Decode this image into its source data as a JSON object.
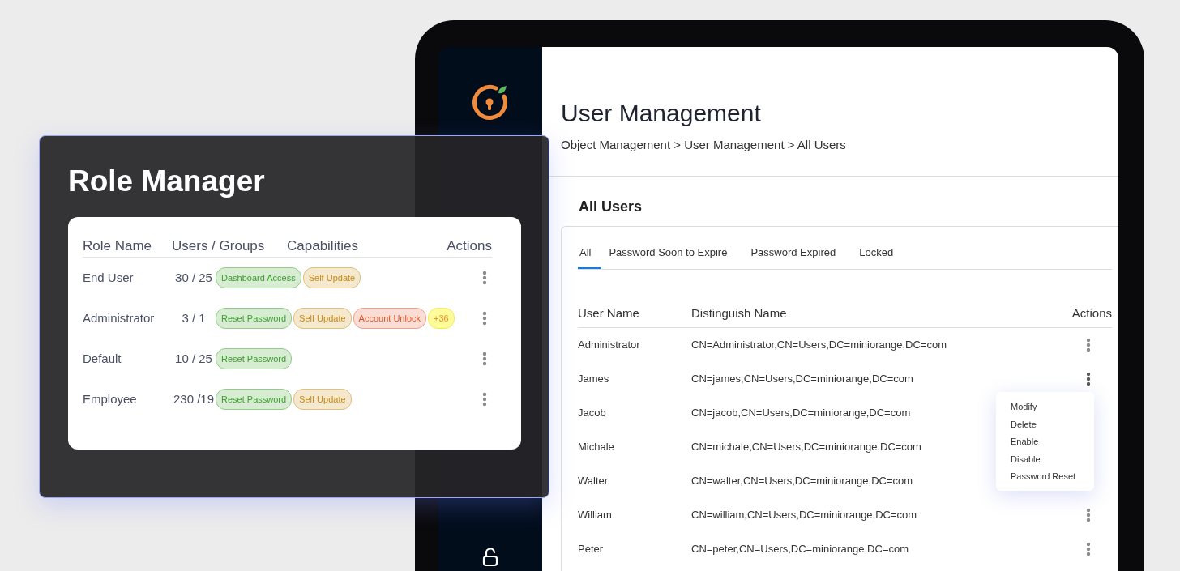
{
  "sidebar": {
    "items": [
      {
        "kind": "logo"
      },
      {
        "kind": "lock"
      }
    ]
  },
  "user_management": {
    "title": "User Management",
    "breadcrumb": "Object Management > User Management > All Users",
    "section_title": "All Users",
    "tabs": [
      {
        "label": "All",
        "selected": true
      },
      {
        "label": "Password Soon to Expire",
        "selected": false
      },
      {
        "label": "Password Expired",
        "selected": false
      },
      {
        "label": "Locked",
        "selected": false
      }
    ],
    "columns": [
      "User Name",
      "Distinguish Name",
      "Actions"
    ],
    "rows": [
      {
        "name": "Administrator",
        "dn": "CN=Administrator,CN=Users,DC=miniorange,DC=com",
        "menu_open": false
      },
      {
        "name": "James",
        "dn": "CN=james,CN=Users,DC=miniorange,DC=com",
        "menu_open": true
      },
      {
        "name": "Jacob",
        "dn": "CN=jacob,CN=Users,DC=miniorange,DC=com",
        "menu_open": false
      },
      {
        "name": "Michale",
        "dn": "CN=michale,CN=Users,DC=miniorange,DC=com",
        "menu_open": false
      },
      {
        "name": "Walter",
        "dn": "CN=walter,CN=Users,DC=miniorange,DC=com",
        "menu_open": false
      },
      {
        "name": "William",
        "dn": "CN=william,CN=Users,DC=miniorange,DC=com",
        "menu_open": false
      },
      {
        "name": "Peter",
        "dn": "CN=peter,CN=Users,DC=miniorange,DC=com",
        "menu_open": false
      }
    ],
    "menu": [
      "Modify",
      "Delete",
      "Enable",
      "Disable",
      "Password Reset"
    ]
  },
  "role_manager": {
    "title": "Role Manager",
    "columns": [
      "Role Name",
      "Users / Groups",
      "Capabilities",
      "Actions"
    ],
    "roles": [
      {
        "name": "End User",
        "count": "30 / 25",
        "capabilities": [
          {
            "label": "Dashboard Access",
            "kind": "capability",
            "color": "#3aa02a"
          },
          {
            "label": "Self Update",
            "kind": "capability",
            "color": "#c98a10"
          }
        ]
      },
      {
        "name": "Administrator",
        "count": "3 / 1",
        "capabilities": [
          {
            "label": "Reset Password",
            "kind": "capability",
            "color": "#3aa02a"
          },
          {
            "label": "Self Update",
            "kind": "capability",
            "color": "#c98a10"
          },
          {
            "label": "Account Unlock",
            "kind": "capability",
            "color": "#e5532a"
          },
          {
            "label": "+36",
            "kind": "more",
            "color": "#fdfb9a"
          }
        ]
      },
      {
        "name": "Default",
        "count": "10 / 25",
        "capabilities": [
          {
            "label": "Reset Password",
            "kind": "capability",
            "color": "#3aa02a"
          }
        ]
      },
      {
        "name": "Employee",
        "count": "230 /19",
        "capabilities": [
          {
            "label": "Reset Password",
            "kind": "capability",
            "color": "#3aa02a"
          },
          {
            "label": "Self Update",
            "kind": "capability",
            "color": "#c98a10"
          }
        ]
      }
    ]
  }
}
